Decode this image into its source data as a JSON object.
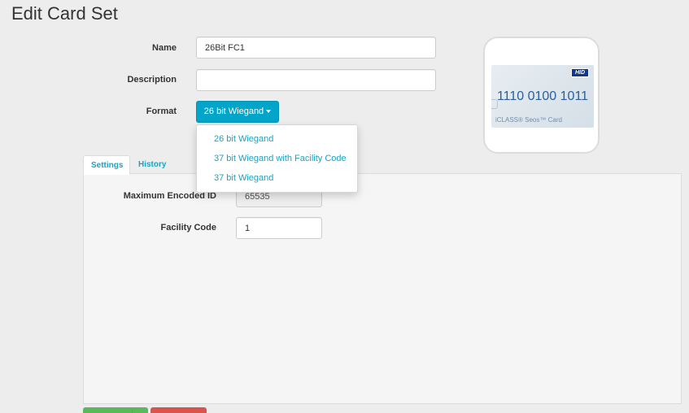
{
  "page": {
    "title": "Edit Card Set"
  },
  "form": {
    "name_label": "Name",
    "name_value": "26Bit FC1",
    "description_label": "Description",
    "description_value": "",
    "format_label": "Format",
    "format_selected": "26 bit Wiegand",
    "format_options": [
      "26 bit Wiegand",
      "37 bit Wiegand with Facility Code",
      "37 bit Wiegand"
    ]
  },
  "card_image": {
    "badge": "HID",
    "number": "1110 0100 1011",
    "brand": "iCLASS® Seos™ Card"
  },
  "tabs": [
    {
      "label": "Settings",
      "active": true
    },
    {
      "label": "History",
      "active": false
    }
  ],
  "settings": {
    "max_encoded_id_label": "Maximum Encoded ID",
    "max_encoded_id_value": "65535",
    "facility_code_label": "Facility Code",
    "facility_code_value": "1"
  },
  "colors": {
    "accent": "#00a5c9",
    "link": "#1ea1c2",
    "success": "#5cb85c",
    "danger": "#d9534f"
  }
}
